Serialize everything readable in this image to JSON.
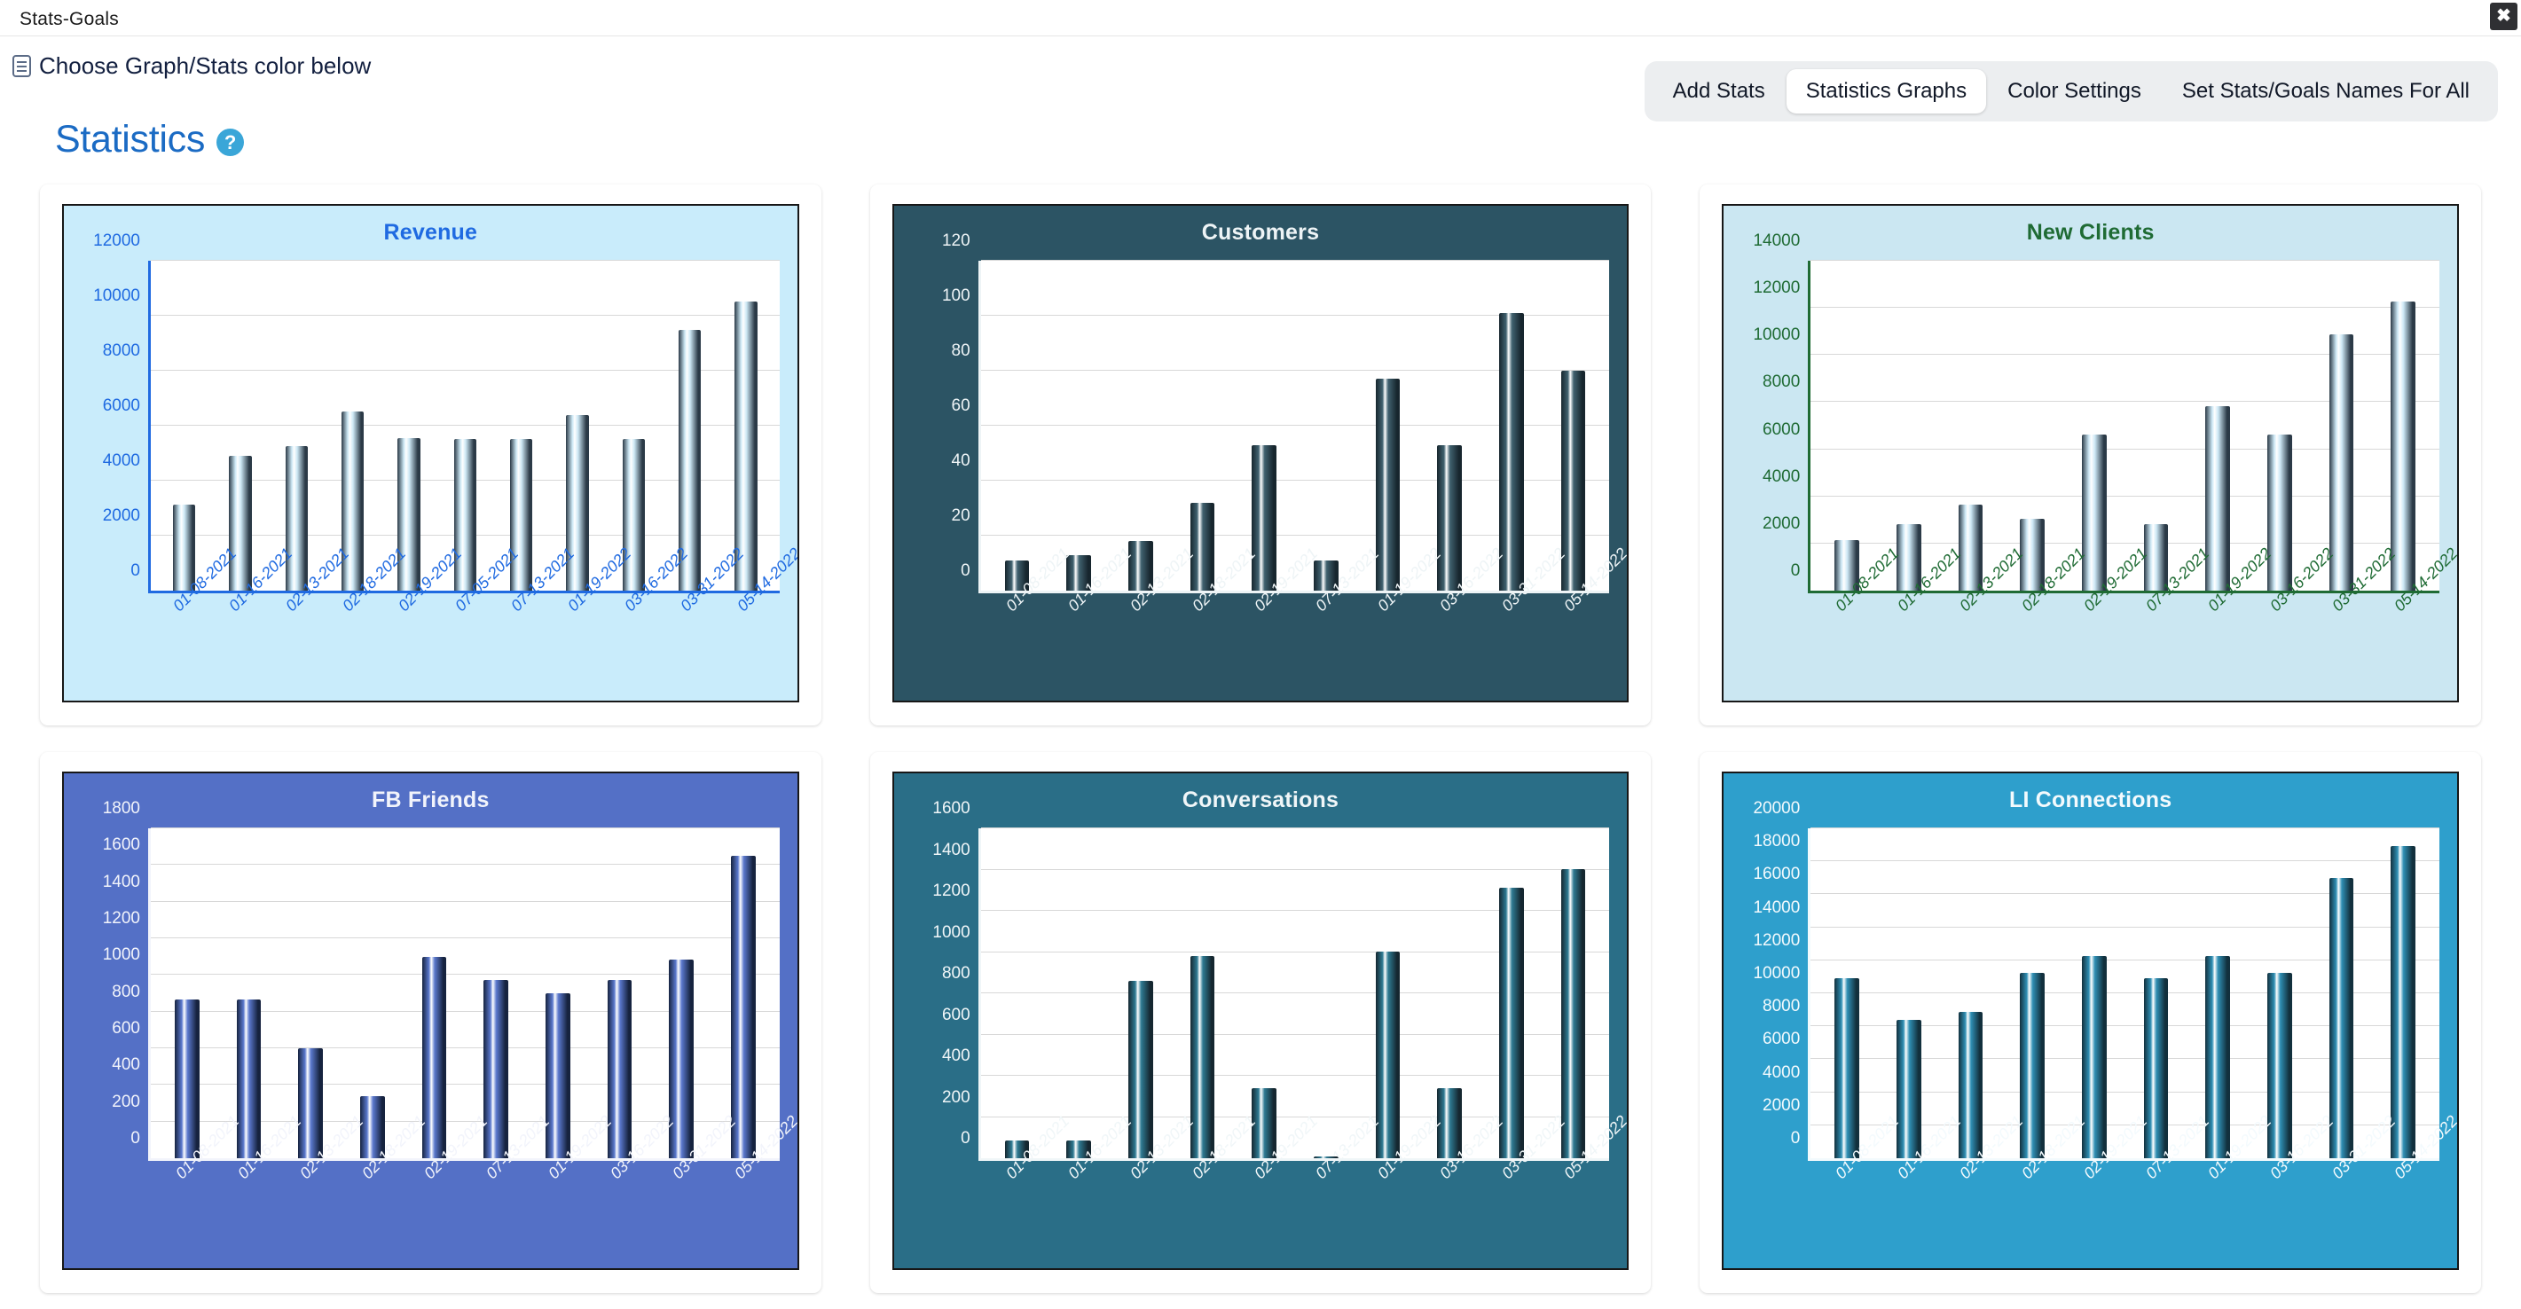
{
  "window": {
    "title": "Stats-Goals",
    "close_label": "✖"
  },
  "toolbar": {
    "color_hint": "Choose Graph/Stats color below",
    "hint_icon": "list-document-icon",
    "tabs": [
      {
        "label": "Add Stats",
        "active": false
      },
      {
        "label": "Statistics Graphs",
        "active": true
      },
      {
        "label": "Color Settings",
        "active": false
      },
      {
        "label": "Set Stats/Goals Names For All",
        "active": false
      }
    ]
  },
  "heading": {
    "title": "Statistics",
    "help_label": "?",
    "title_color": "#1b6bc4",
    "help_color": "#3aa6d8"
  },
  "chart_data": [
    {
      "type": "bar",
      "title": "Revenue",
      "xlabel": "",
      "ylabel": "",
      "ylim": [
        0,
        12000
      ],
      "yticks": [
        0,
        2000,
        4000,
        6000,
        8000,
        10000,
        12000
      ],
      "grid": true,
      "legend": "none",
      "bg": "#c9ecfb",
      "text_color": "#1f6ae1",
      "bar_dark": "#2b3a47",
      "bar_light": "#cde8f5",
      "categories": [
        "01-08-2021",
        "01-16-2021",
        "02-13-2021",
        "02-18-2021",
        "02-19-2021",
        "07-05-2021",
        "07-13-2021",
        "01-19-2022",
        "03-16-2022",
        "03-31-2022",
        "05-14-2022"
      ],
      "values": [
        3120,
        4890,
        5260,
        6510,
        5550,
        5510,
        5510,
        6390,
        5510,
        9490,
        10520
      ]
    },
    {
      "type": "bar",
      "title": "Customers",
      "xlabel": "",
      "ylabel": "",
      "ylim": [
        0,
        120
      ],
      "yticks": [
        0,
        20,
        40,
        60,
        80,
        100,
        120
      ],
      "grid": true,
      "legend": "none",
      "bg": "#2c5464",
      "text_color": "#eef4f6",
      "bar_dark": "#17262e",
      "bar_light": "#40616f",
      "categories": [
        "01-08-2021",
        "01-16-2021",
        "02-13-2021",
        "02-18-2021",
        "02-19-2021",
        "07-13-2021",
        "01-19-2022",
        "03-16-2022",
        "03-31-2022",
        "05-14-2022"
      ],
      "values": [
        11,
        13,
        18,
        32,
        53,
        11,
        77,
        53,
        101,
        80
      ]
    },
    {
      "type": "bar",
      "title": "New Clients",
      "xlabel": "",
      "ylabel": "",
      "ylim": [
        0,
        14000
      ],
      "yticks": [
        0,
        2000,
        4000,
        6000,
        8000,
        10000,
        12000,
        14000
      ],
      "grid": true,
      "legend": "none",
      "bg": "#cbe7f2",
      "text_color": "#1f6b34",
      "bar_dark": "#2b3a47",
      "bar_light": "#cde8f5",
      "categories": [
        "01-08-2021",
        "01-16-2021",
        "02-13-2021",
        "02-18-2021",
        "02-19-2021",
        "07-13-2021",
        "01-19-2022",
        "03-16-2022",
        "03-31-2022",
        "05-14-2022"
      ],
      "values": [
        2140,
        2840,
        3640,
        3060,
        6640,
        2840,
        7820,
        6640,
        10880,
        12280
      ]
    },
    {
      "type": "bar",
      "title": "FB Friends",
      "xlabel": "",
      "ylabel": "",
      "ylim": [
        0,
        1800
      ],
      "yticks": [
        0,
        200,
        400,
        600,
        800,
        1000,
        1200,
        1400,
        1600,
        1800
      ],
      "grid": true,
      "legend": "none",
      "bg": "#5470c6",
      "text_color": "#f2f4fb",
      "bar_dark": "#16233f",
      "bar_light": "#5a78cd",
      "categories": [
        "01-08-2021",
        "01-16-2021",
        "02-13-2021",
        "02-18-2021",
        "02-19-2021",
        "07-13-2021",
        "01-19-2022",
        "03-16-2022",
        "03-31-2022",
        "05-14-2022"
      ],
      "values": [
        865,
        865,
        598,
        338,
        1098,
        972,
        902,
        972,
        1086,
        1650
      ]
    },
    {
      "type": "bar",
      "title": "Conversations",
      "xlabel": "",
      "ylabel": "",
      "ylim": [
        0,
        1600
      ],
      "yticks": [
        0,
        200,
        400,
        600,
        800,
        1000,
        1200,
        1400,
        1600
      ],
      "grid": true,
      "legend": "none",
      "bg": "#2a6e87",
      "text_color": "#f0f6f8",
      "bar_dark": "#152730",
      "bar_light": "#2e7a92",
      "categories": [
        "01-08-2021",
        "01-16-2021",
        "02-13-2021",
        "02-18-2021",
        "02-19-2021",
        "07-13-2021",
        "01-19-2022",
        "03-16-2022",
        "03-31-2022",
        "05-14-2022"
      ],
      "values": [
        88,
        88,
        862,
        982,
        340,
        10,
        1004,
        340,
        1312,
        1404
      ]
    },
    {
      "type": "bar",
      "title": "LI Connections",
      "xlabel": "",
      "ylabel": "",
      "ylim": [
        0,
        20000
      ],
      "yticks": [
        0,
        2000,
        4000,
        6000,
        8000,
        10000,
        12000,
        14000,
        16000,
        18000,
        20000
      ],
      "grid": true,
      "legend": "none",
      "bg": "#2e9fcc",
      "text_color": "#f3fafd",
      "bar_dark": "#12303d",
      "bar_light": "#2f8fb4",
      "categories": [
        "01-08-2021",
        "01-16-2021",
        "02-13-2021",
        "02-18-2021",
        "02-19-2021",
        "07-13-2021",
        "01-19-2022",
        "03-16-2022",
        "03-31-2022",
        "05-14-2022"
      ],
      "values": [
        10900,
        8380,
        8870,
        11230,
        12240,
        10900,
        12240,
        11230,
        17000,
        18900
      ]
    }
  ]
}
